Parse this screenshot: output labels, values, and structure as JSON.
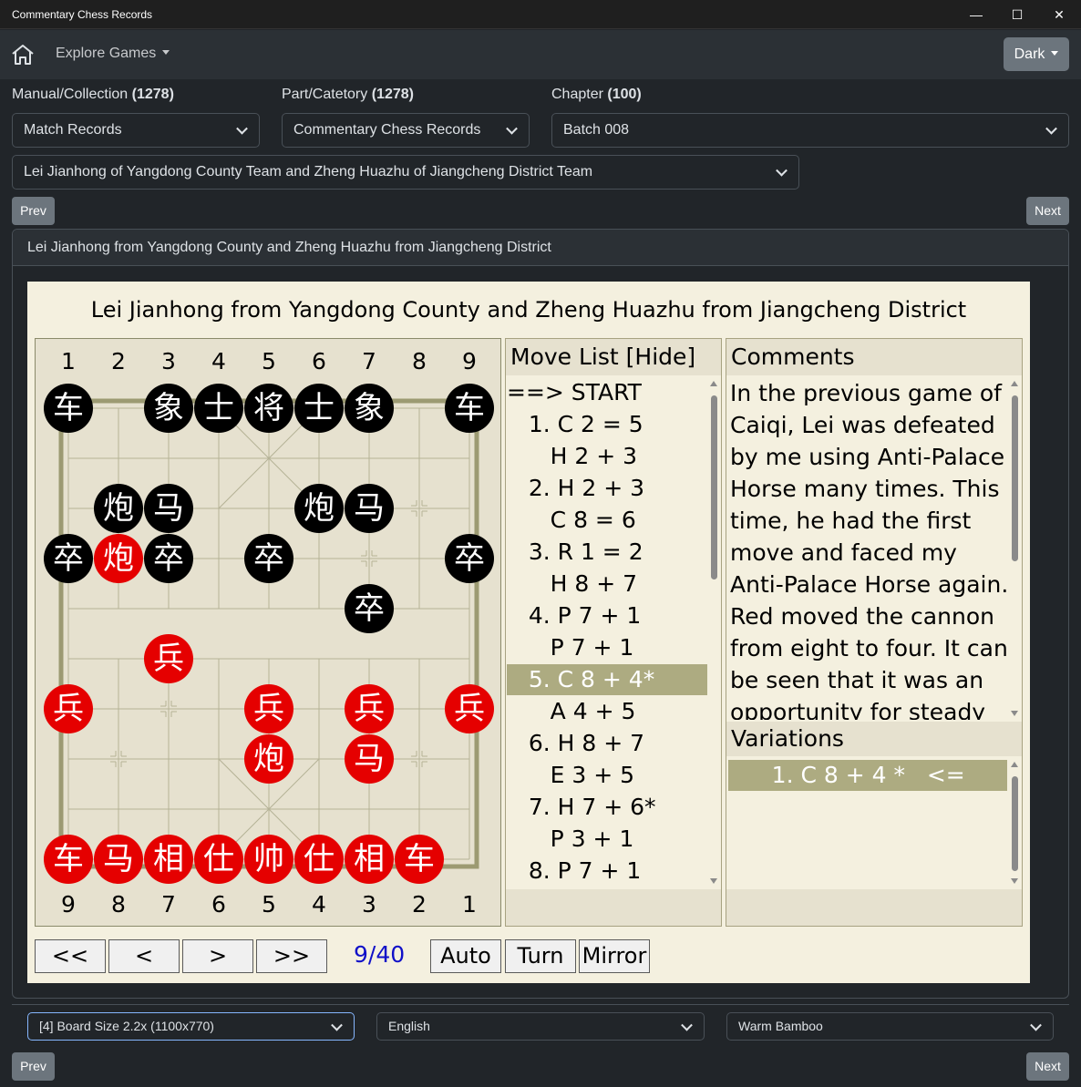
{
  "window": {
    "title": "Commentary Chess Records",
    "minimize": "—",
    "maximize": "☐",
    "close": "✕"
  },
  "navbar": {
    "home_icon": "home-icon",
    "explore_label": "Explore Games",
    "theme_button": "Dark"
  },
  "filters": {
    "manual": {
      "label": "Manual/Collection",
      "count": "(1278)",
      "value": "Match Records"
    },
    "part": {
      "label": "Part/Catetory",
      "count": "(1278)",
      "value": "Commentary Chess Records"
    },
    "chapter": {
      "label": "Chapter",
      "count": "(100)",
      "value": "Batch 008"
    },
    "game": {
      "value": "Lei Jianhong of Yangdong County Team and Zheng Huazhu of Jiangcheng District Team"
    }
  },
  "pager": {
    "prev": "Prev",
    "next": "Next"
  },
  "card": {
    "header": "Lei Jianhong from Yangdong County and Zheng Huazhu from Jiangcheng District"
  },
  "game": {
    "title": "Lei Jianhong from Yangdong County and Zheng Huazhu from Jiangcheng District",
    "top_numbers": [
      "1",
      "2",
      "3",
      "4",
      "5",
      "6",
      "7",
      "8",
      "9"
    ],
    "bottom_numbers": [
      "9",
      "8",
      "7",
      "6",
      "5",
      "4",
      "3",
      "2",
      "1"
    ],
    "pieces": [
      {
        "c": 0,
        "r": 0,
        "t": "车",
        "s": "b"
      },
      {
        "c": 2,
        "r": 0,
        "t": "象",
        "s": "b"
      },
      {
        "c": 3,
        "r": 0,
        "t": "士",
        "s": "b"
      },
      {
        "c": 4,
        "r": 0,
        "t": "将",
        "s": "b"
      },
      {
        "c": 5,
        "r": 0,
        "t": "士",
        "s": "b"
      },
      {
        "c": 6,
        "r": 0,
        "t": "象",
        "s": "b"
      },
      {
        "c": 8,
        "r": 0,
        "t": "车",
        "s": "b"
      },
      {
        "c": 1,
        "r": 2,
        "t": "炮",
        "s": "b"
      },
      {
        "c": 2,
        "r": 2,
        "t": "马",
        "s": "b"
      },
      {
        "c": 5,
        "r": 2,
        "t": "炮",
        "s": "b"
      },
      {
        "c": 6,
        "r": 2,
        "t": "马",
        "s": "b"
      },
      {
        "c": 0,
        "r": 3,
        "t": "卒",
        "s": "b"
      },
      {
        "c": 1,
        "r": 3,
        "t": "炮",
        "s": "r"
      },
      {
        "c": 2,
        "r": 3,
        "t": "卒",
        "s": "b"
      },
      {
        "c": 4,
        "r": 3,
        "t": "卒",
        "s": "b"
      },
      {
        "c": 8,
        "r": 3,
        "t": "卒",
        "s": "b"
      },
      {
        "c": 6,
        "r": 4,
        "t": "卒",
        "s": "b"
      },
      {
        "c": 2,
        "r": 5,
        "t": "兵",
        "s": "r"
      },
      {
        "c": 0,
        "r": 6,
        "t": "兵",
        "s": "r"
      },
      {
        "c": 4,
        "r": 6,
        "t": "兵",
        "s": "r"
      },
      {
        "c": 6,
        "r": 6,
        "t": "兵",
        "s": "r"
      },
      {
        "c": 8,
        "r": 6,
        "t": "兵",
        "s": "r"
      },
      {
        "c": 4,
        "r": 7,
        "t": "炮",
        "s": "r"
      },
      {
        "c": 6,
        "r": 7,
        "t": "马",
        "s": "r"
      },
      {
        "c": 0,
        "r": 9,
        "t": "车",
        "s": "r"
      },
      {
        "c": 1,
        "r": 9,
        "t": "马",
        "s": "r"
      },
      {
        "c": 2,
        "r": 9,
        "t": "相",
        "s": "r"
      },
      {
        "c": 3,
        "r": 9,
        "t": "仕",
        "s": "r"
      },
      {
        "c": 4,
        "r": 9,
        "t": "帅",
        "s": "r"
      },
      {
        "c": 5,
        "r": 9,
        "t": "仕",
        "s": "r"
      },
      {
        "c": 6,
        "r": 9,
        "t": "相",
        "s": "r"
      },
      {
        "c": 7,
        "r": 9,
        "t": "车",
        "s": "r"
      }
    ],
    "move_list": {
      "title": "Move List [Hide]",
      "items": [
        "==> START",
        "   1. C 2 = 5",
        "      H 2 + 3",
        "   2. H 2 + 3",
        "      C 8 = 6",
        "   3. R 1 = 2",
        "      H 8 + 7",
        "   4. P 7 + 1",
        "      P 7 + 1",
        "   5. C 8 + 4*",
        "      A 4 + 5",
        "   6. H 8 + 7",
        "      E 3 + 5",
        "   7. H 7 + 6*",
        "      P 3 + 1",
        "   8. P 7 + 1"
      ],
      "selected_index": 9
    },
    "comments": {
      "title": "Comments",
      "text": "In the previous game of Caiqi, Lei was defeated by me using Anti-Palace Horse many times. This time, he had the first move and faced my Anti-Palace Horse again. Red moved the cannon from eight to four. It can be seen that it was an opportunity for steady advancement. This"
    },
    "variations": {
      "title": "Variations",
      "items": [
        "      1. C 8 + 4 *   <="
      ]
    },
    "controls": {
      "first": "<<",
      "prev": "<",
      "next": ">",
      "last": ">>",
      "counter": "9/40",
      "auto": "Auto",
      "turn": "Turn",
      "mirror": "Mirror"
    }
  },
  "footer": {
    "board_size": "[4] Board Size 2.2x (1100x770)",
    "language": "English",
    "theme": "Warm Bamboo"
  },
  "colors": {
    "red": "#e50000",
    "black": "#000000",
    "highlight": "#adab81",
    "counter": "#1010c8"
  }
}
